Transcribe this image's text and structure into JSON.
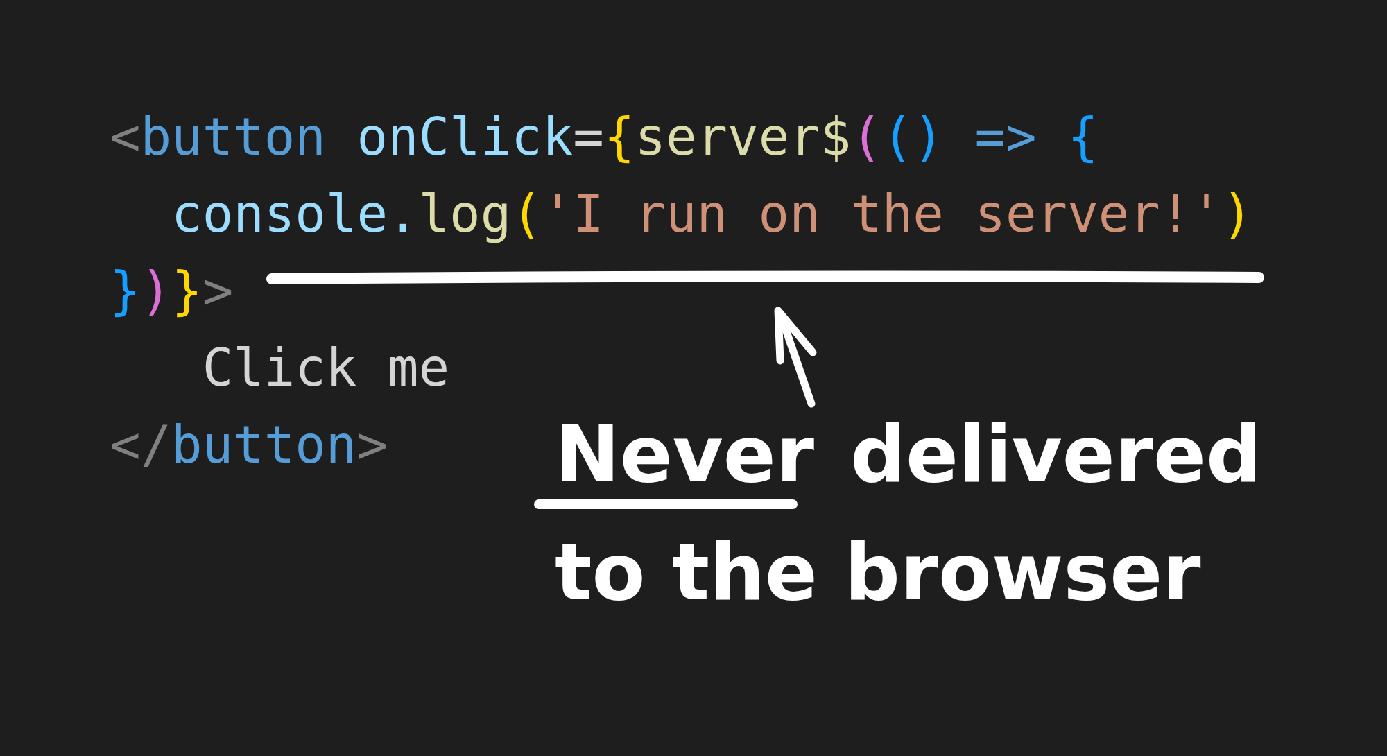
{
  "code_lines": [
    {
      "tokens": [
        {
          "text": "<",
          "color": "#808080"
        },
        {
          "text": "button",
          "color": "#569cd6"
        },
        {
          "text": " onClick",
          "color": "#9cdcfe"
        },
        {
          "text": "=",
          "color": "#d4d4d4"
        },
        {
          "text": "{",
          "color": "#ffd700"
        },
        {
          "text": "server$",
          "color": "#dcdcaa"
        },
        {
          "text": "(",
          "color": "#da70d6"
        },
        {
          "text": "()",
          "color": "#179fff"
        },
        {
          "text": " =>",
          "color": "#569cd6"
        },
        {
          "text": " {",
          "color": "#179fff"
        }
      ]
    },
    {
      "tokens": [
        {
          "text": "  console.",
          "color": "#9cdcfe"
        },
        {
          "text": "log",
          "color": "#dcdcaa"
        },
        {
          "text": "(",
          "color": "#ffd700"
        },
        {
          "text": "'I run on the server!'",
          "color": "#ce9178"
        },
        {
          "text": ")",
          "color": "#ffd700"
        }
      ]
    },
    {
      "tokens": [
        {
          "text": "}",
          "color": "#179fff"
        },
        {
          "text": ")",
          "color": "#da70d6"
        },
        {
          "text": "}",
          "color": "#ffd700"
        },
        {
          "text": ">",
          "color": "#808080"
        }
      ]
    },
    {
      "tokens": [
        {
          "text": "   Click me",
          "color": "#d4d4d4"
        }
      ]
    },
    {
      "tokens": [
        {
          "text": "</",
          "color": "#808080"
        },
        {
          "text": "button",
          "color": "#569cd6"
        },
        {
          "text": ">",
          "color": "#808080"
        }
      ]
    }
  ],
  "note": {
    "underlined_word": "Never",
    "line_1_rest": "delivered",
    "line_2": "to the browser"
  }
}
